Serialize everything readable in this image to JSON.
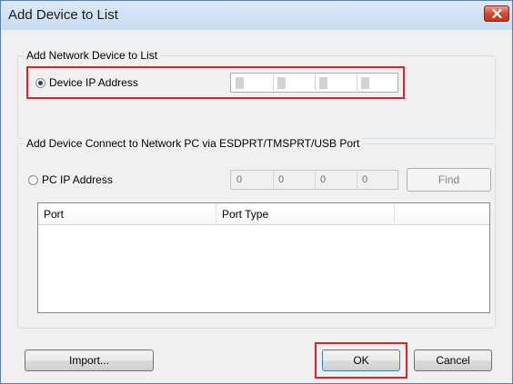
{
  "window": {
    "title": "Add Device to List"
  },
  "network_group": {
    "label": "Add Network Device to List",
    "radio_label": "Device IP Address",
    "radio_checked": true,
    "ip_octets": [
      "",
      "",
      "",
      ""
    ]
  },
  "port_group": {
    "label": "Add Device Connect to Network PC via ESDPRT/TMSPRT/USB Port",
    "radio_label": "PC IP Address",
    "radio_checked": false,
    "ip_octets": [
      "0",
      "0",
      "0",
      "0"
    ],
    "find_label": "Find",
    "columns": [
      "Port",
      "Port Type",
      ""
    ]
  },
  "footer": {
    "import_label": "Import...",
    "ok_label": "OK",
    "cancel_label": "Cancel"
  },
  "icons": {
    "close": "close-icon",
    "radio_selected": "radio-selected-icon",
    "radio_unselected": "radio-unselected-icon"
  },
  "colors": {
    "highlight": "#e0202a",
    "close_button": "#d24a2e",
    "titlebar": "#c9dbef"
  }
}
